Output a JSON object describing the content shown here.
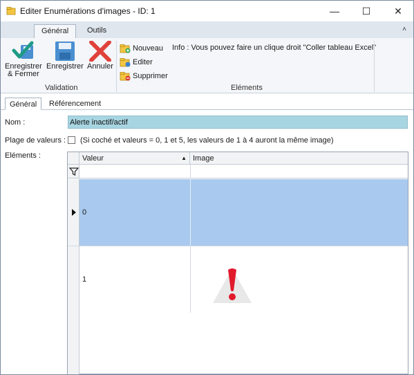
{
  "window": {
    "title": "Editer Enumérations d'images - ID: 1",
    "minimize": "—",
    "maximize": "☐",
    "close": "✕"
  },
  "ribbon": {
    "tabs": [
      "Général",
      "Outils"
    ],
    "collapse": "˄",
    "validation": {
      "save_close": [
        "Enregistrer",
        "& Fermer"
      ],
      "save": "Enregistrer",
      "cancel": "Annuler",
      "group_label": "Validation"
    },
    "elements": {
      "new": "Nouveau",
      "edit": "Editer",
      "delete": "Supprimer",
      "group_label": "Eléments",
      "info": "Info : Vous pouvez faire un clique droit \"Coller tableau Excel\""
    }
  },
  "form_tabs": [
    "Général",
    "Référencement"
  ],
  "form": {
    "name_label": "Nom :",
    "name_value": "Alerte inactif/actif",
    "range_label": "Plage de valeurs :",
    "range_note": "(Si coché et valeurs = 0, 1 et 5, les valeurs de 1 à 4 auront la même image)",
    "elements_label": "Eléments :"
  },
  "grid": {
    "columns": [
      "Valeur",
      "Image"
    ],
    "sort_indicator": "▲",
    "rows": [
      {
        "value": "0",
        "selected": true
      },
      {
        "value": "1",
        "selected": false
      }
    ]
  },
  "colors": {
    "selected_row": "#a9c9ee",
    "name_field": "#a8d5e2",
    "save_icon": "#4a8fd0",
    "cancel_icon": "#e0413a",
    "check_icon": "#1e9a86"
  }
}
